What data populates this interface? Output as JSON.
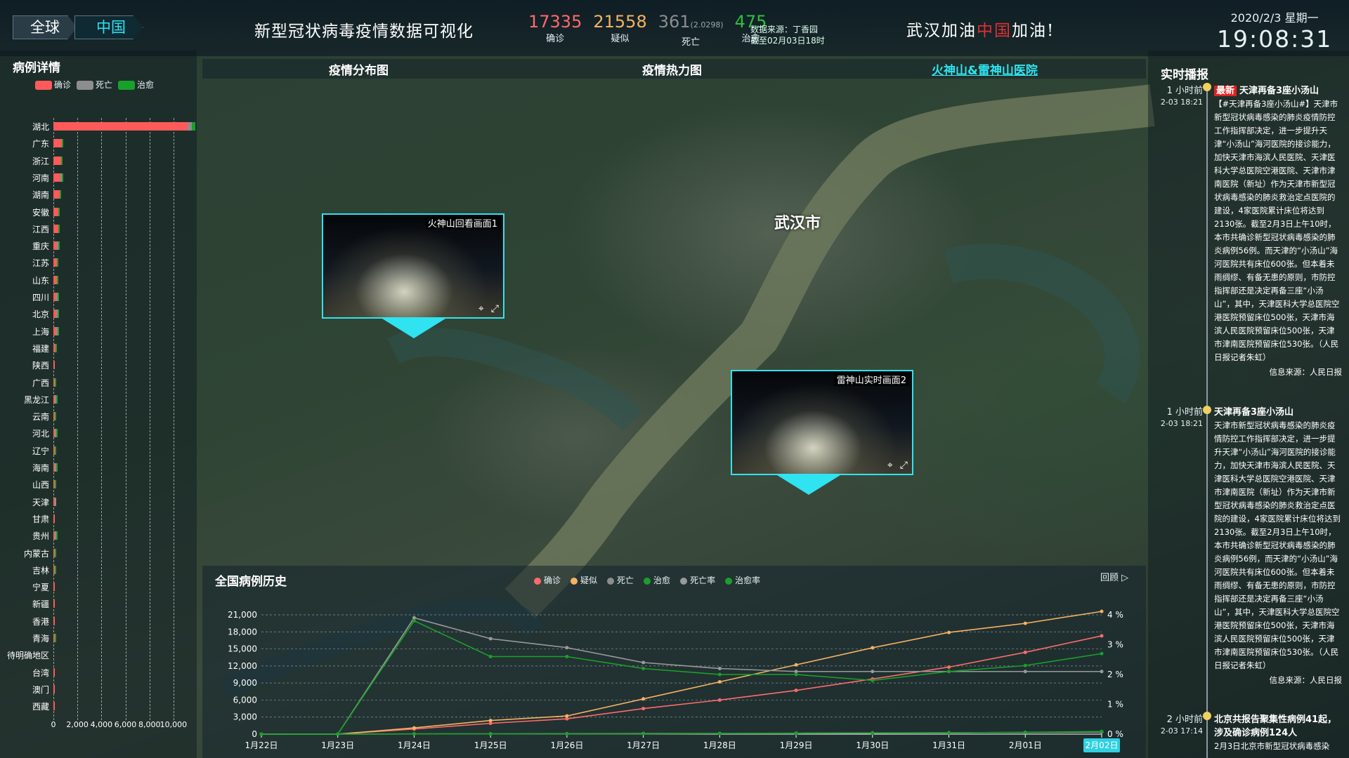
{
  "header": {
    "scope_global": "全球",
    "scope_china": "中国",
    "title": "新型冠状病毒疫情数据可视化",
    "stats": [
      {
        "value": "17335",
        "label": "确诊",
        "color": "#ff6a6a"
      },
      {
        "value": "21558",
        "label": "疑似",
        "color": "#f5b264"
      },
      {
        "value": "361",
        "sub": "(2.0298)",
        "label": "死亡",
        "color": "#8d8d8d"
      },
      {
        "value": "475",
        "label": "治愈",
        "color": "#2fbf3f"
      }
    ],
    "source_line1": "数据来源：丁香园",
    "source_line2": "截至02月03日18时",
    "slogan_a": "武汉加油",
    "slogan_b": "中国",
    "slogan_c": "加油!",
    "date": "2020/2/3 星期一",
    "time": "19:08:31"
  },
  "left": {
    "title": "病例详情",
    "legend": [
      {
        "label": "确诊",
        "color": "#ff5a5a"
      },
      {
        "label": "死亡",
        "color": "#8d8d8d"
      },
      {
        "label": "治愈",
        "color": "#1aa02a"
      }
    ],
    "xticks": [
      "0",
      "2,000",
      "4,000",
      "6,000",
      "8,000",
      "10,000"
    ]
  },
  "chart_data": [
    {
      "type": "bar",
      "title": "病例详情",
      "orientation": "horizontal",
      "categories": [
        "湖北",
        "广东",
        "浙江",
        "河南",
        "湖南",
        "安徽",
        "江西",
        "重庆",
        "江苏",
        "山东",
        "四川",
        "北京",
        "上海",
        "福建",
        "陕西",
        "广西",
        "黑龙江",
        "云南",
        "河北",
        "辽宁",
        "海南",
        "山西",
        "天津",
        "甘肃",
        "贵州",
        "内蒙古",
        "吉林",
        "宁夏",
        "新疆",
        "香港",
        "青海",
        "待明确地区",
        "台湾",
        "澳门",
        "西藏"
      ],
      "series": [
        {
          "name": "确诊",
          "values": [
            11177,
            683,
            661,
            566,
            521,
            408,
            391,
            300,
            271,
            270,
            231,
            212,
            219,
            179,
            128,
            127,
            118,
            117,
            104,
            78,
            63,
            74,
            60,
            51,
            38,
            34,
            42,
            31,
            24,
            15,
            13,
            0,
            10,
            8,
            1
          ]
        },
        {
          "name": "死亡",
          "values": [
            350,
            0,
            0,
            2,
            0,
            0,
            0,
            2,
            0,
            0,
            1,
            1,
            1,
            0,
            0,
            0,
            2,
            0,
            1,
            0,
            1,
            0,
            1,
            0,
            1,
            0,
            0,
            0,
            0,
            0,
            0,
            0,
            0,
            0,
            0
          ]
        },
        {
          "name": "治愈",
          "values": [
            295,
            20,
            26,
            20,
            16,
            5,
            15,
            9,
            9,
            4,
            16,
            12,
            10,
            4,
            0,
            2,
            1,
            5,
            2,
            1,
            1,
            2,
            0,
            0,
            1,
            1,
            1,
            0,
            0,
            0,
            1,
            0,
            0,
            0,
            0
          ]
        }
      ],
      "xlim": [
        0,
        11000
      ],
      "xticks": [
        0,
        2000,
        4000,
        6000,
        8000,
        10000
      ]
    },
    {
      "type": "line",
      "title": "全国病例历史",
      "x": [
        "1月22日",
        "1月23日",
        "1月24日",
        "1月25日",
        "1月26日",
        "1月27日",
        "1月28日",
        "1月29日",
        "1月30日",
        "1月31日",
        "2月01日",
        "2月02日"
      ],
      "series": [
        {
          "name": "确诊",
          "color": "#ff6b6b",
          "axis": "left",
          "values": [
            0,
            0,
            900,
            1900,
            2700,
            4500,
            6000,
            7700,
            9700,
            11800,
            14400,
            17300
          ]
        },
        {
          "name": "疑似",
          "color": "#f5b264",
          "axis": "left",
          "values": [
            0,
            0,
            1100,
            2400,
            3200,
            6200,
            9200,
            12200,
            15200,
            17900,
            19500,
            21600
          ]
        },
        {
          "name": "死亡",
          "color": "#8d8d8d",
          "axis": "left",
          "values": [
            0,
            0,
            40,
            60,
            80,
            110,
            130,
            170,
            210,
            260,
            300,
            361
          ]
        },
        {
          "name": "治愈",
          "color": "#1aa02a",
          "axis": "left",
          "values": [
            0,
            0,
            40,
            40,
            50,
            60,
            100,
            120,
            170,
            240,
            330,
            475
          ]
        },
        {
          "name": "死亡率",
          "color": "#9a9a9a",
          "axis": "right",
          "values": [
            0,
            0,
            3.9,
            3.2,
            2.9,
            2.4,
            2.2,
            2.1,
            2.1,
            2.1,
            2.1,
            2.1
          ]
        },
        {
          "name": "治愈率",
          "color": "#1aa02a",
          "axis": "right",
          "values": [
            0,
            0,
            3.8,
            2.6,
            2.6,
            2.2,
            2.0,
            2.0,
            1.8,
            2.1,
            2.3,
            2.7
          ]
        }
      ],
      "ylim": [
        0,
        21000
      ],
      "yticks": [
        "0",
        "3,000",
        "6,000",
        "9,000",
        "12,000",
        "15,000",
        "18,000",
        "21,000"
      ],
      "y2lim": [
        0,
        4
      ],
      "y2ticks": [
        "0 %",
        "1 %",
        "2 %",
        "3 %",
        "4 %"
      ],
      "legend_position": "top-center",
      "selected_x": "2月02日",
      "grid": true
    }
  ],
  "map": {
    "tabs": [
      "疫情分布图",
      "疫情热力图",
      "火神山&雷神山医院"
    ],
    "city": "武汉市",
    "popup1_caption": "火神山回看画面1",
    "popup2_caption": "雷神山实时画面2"
  },
  "history": {
    "title": "全国病例历史",
    "replay": "回顾"
  },
  "right": {
    "title": "实时播报",
    "news": [
      {
        "time_ago": "1 小时前",
        "date": "2-03 18:21",
        "tag": "最新",
        "headline": "天津再备3座小汤山",
        "body": "【#天津再备3座小汤山#】天津市新型冠状病毒感染的肺炎疫情防控工作指挥部决定，进一步提升天津“小汤山”海河医院的接诊能力，加快天津市海滨人民医院、天津医科大学总医院空港医院、天津市津南医院（新址）作为天津市新型冠状病毒感染的肺炎救治定点医院的建设，4家医院累计床位将达到2130张。截至2月3日上午10时，本市共确诊新型冠状病毒感染的肺炎病例56例。而天津的“小汤山”海河医院共有床位600张。但本着未雨绸缪、有备无患的原则，市防控指挥部还是决定再备三座“小汤山”，其中，天津医科大学总医院空港医院预留床位500张，天津市海滨人民医院预留床位500张，天津市津南医院预留床位530张。（人民日报记者朱虹）",
        "source": "信息来源：人民日报"
      },
      {
        "time_ago": "1 小时前",
        "date": "2-03 18:21",
        "headline": "天津再备3座小汤山",
        "body": "天津市新型冠状病毒感染的肺炎疫情防控工作指挥部决定，进一步提升天津“小汤山”海河医院的接诊能力，加快天津市海滨人民医院、天津医科大学总医院空港医院、天津市津南医院（新址）作为天津市新型冠状病毒感染的肺炎救治定点医院的建设，4家医院累计床位将达到2130张。截至2月3日上午10时，本市共确诊新型冠状病毒感染的肺炎病例56例，而天津的“小汤山”海河医院共有床位600张。但本着未雨绸缪、有备无患的原则，市防控指挥部还是决定再备三座“小汤山”，其中，天津医科大学总医院空港医院预留床位500张，天津市海滨人民医院预留床位500张，天津市津南医院预留床位530张。（人民日报记者朱虹）",
        "source": "信息来源：人民日报"
      },
      {
        "time_ago": "2 小时前",
        "date": "2-03 17:14",
        "headline": "北京共报告聚集性病例41起，涉及确诊病例124人",
        "body": "2月3日北京市新型冠状病毒感染"
      }
    ]
  }
}
